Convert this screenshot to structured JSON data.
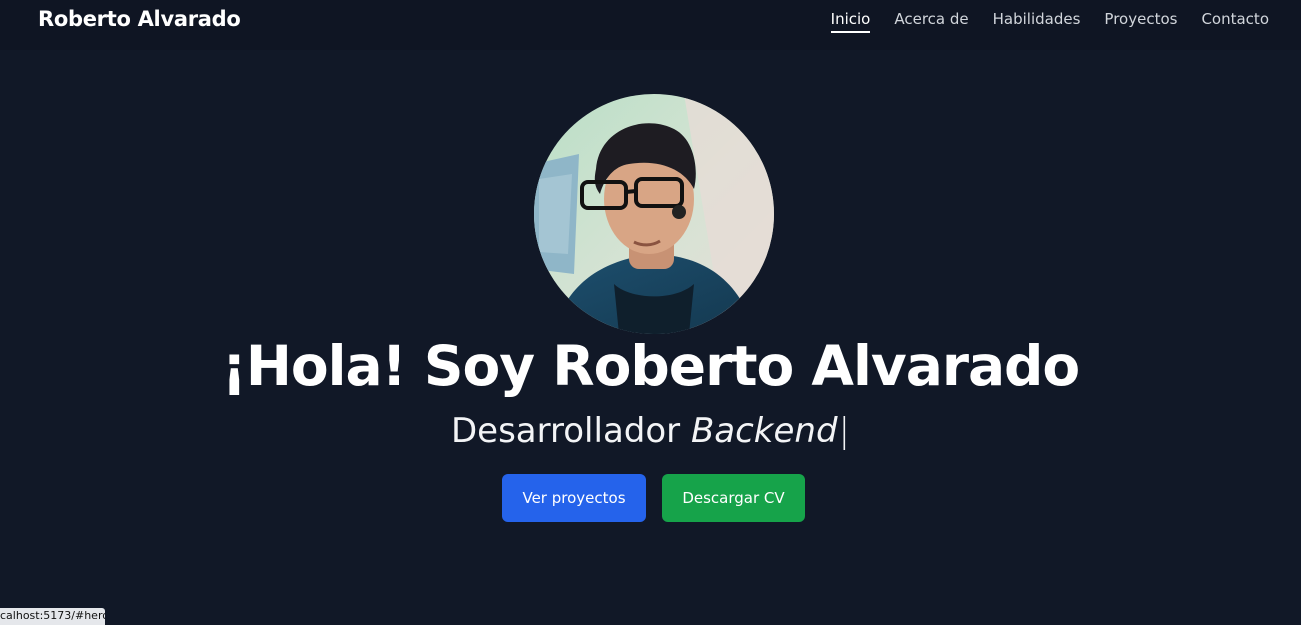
{
  "header": {
    "brand": "Roberto Alvarado",
    "nav": [
      {
        "label": "Inicio",
        "active": true
      },
      {
        "label": "Acerca de",
        "active": false
      },
      {
        "label": "Habilidades",
        "active": false
      },
      {
        "label": "Proyectos",
        "active": false
      },
      {
        "label": "Contacto",
        "active": false
      }
    ]
  },
  "hero": {
    "title": "¡Hola! Soy Roberto Alvarado",
    "subtitle_plain": "Desarrollador ",
    "subtitle_emphasis": "Backend",
    "caret": "|",
    "buttons": {
      "projects": "Ver proyectos",
      "cv": "Descargar CV"
    }
  },
  "status_bar": {
    "url": "calhost:5173/#hero"
  },
  "colors": {
    "background": "#111827",
    "navbar": "#0f1523",
    "primary_button": "#2563eb",
    "secondary_button": "#16a34a"
  }
}
